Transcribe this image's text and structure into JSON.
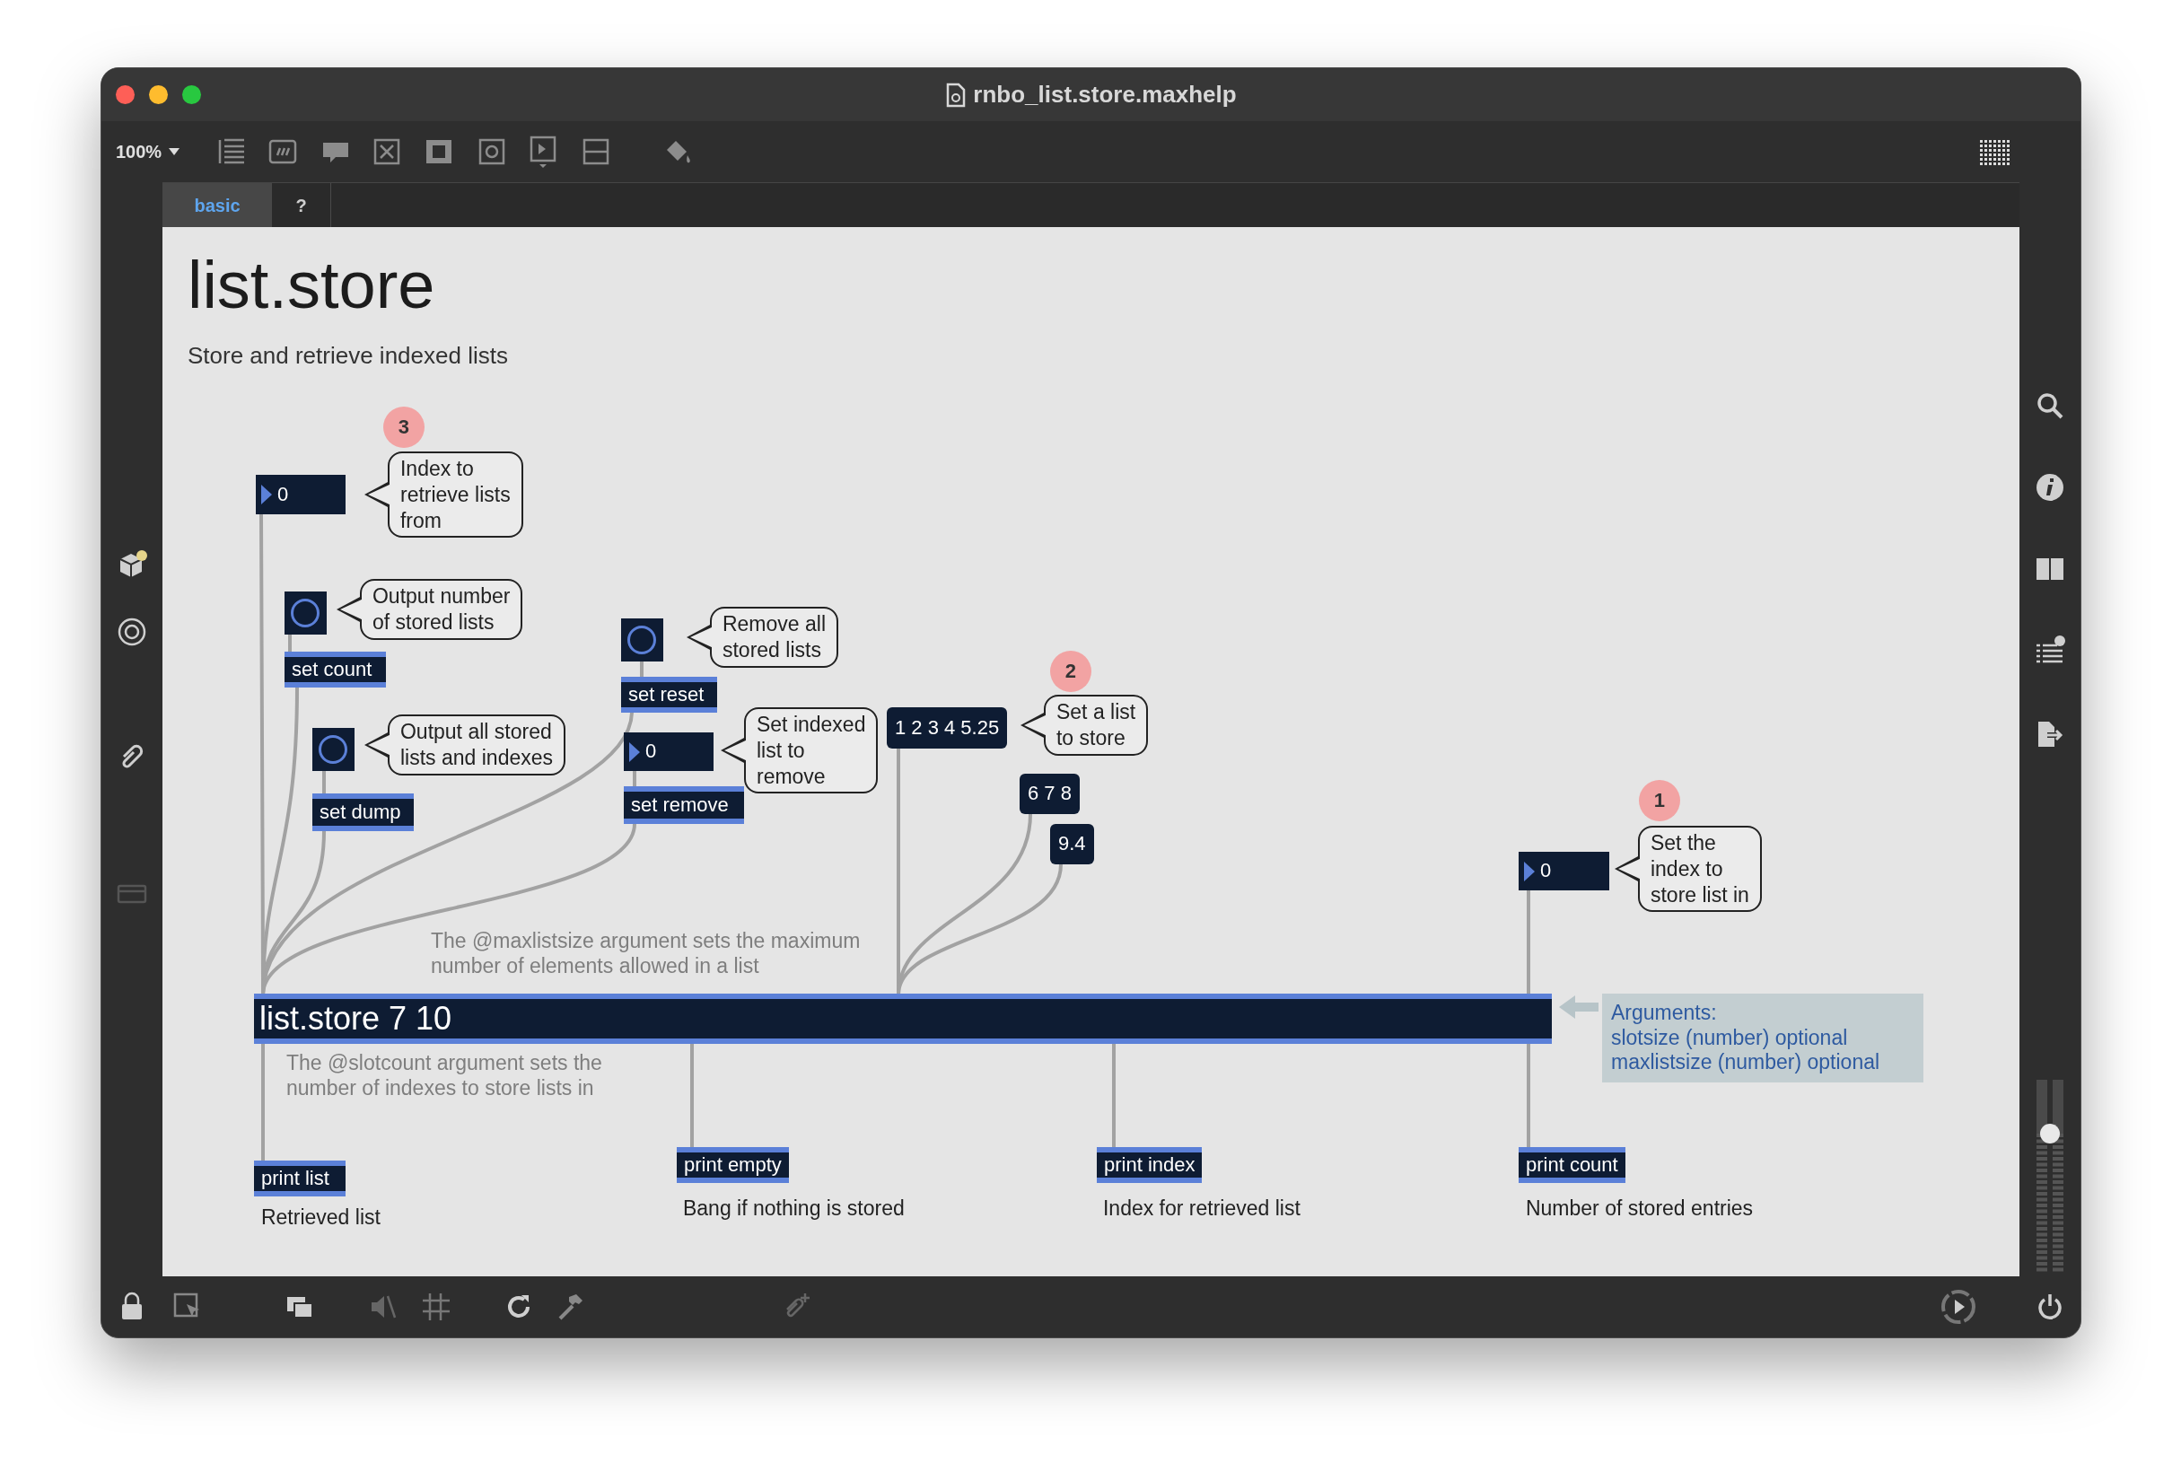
{
  "window": {
    "title": "rnbo_list.store.maxhelp"
  },
  "toolbar": {
    "zoom": "100%"
  },
  "tabs": [
    {
      "label": "basic",
      "selected": true
    },
    {
      "label": "?",
      "selected": false
    }
  ],
  "patcher": {
    "title": "list.store",
    "subtitle": "Store and retrieve indexed lists",
    "objects": [
      {
        "kind": "badge",
        "text": "3"
      },
      {
        "kind": "number",
        "text": "0"
      },
      {
        "kind": "callout",
        "lines": [
          "Index to",
          "retrieve lists",
          "from"
        ]
      },
      {
        "kind": "button"
      },
      {
        "kind": "callout",
        "lines": [
          "Output number",
          "of stored lists"
        ]
      },
      {
        "kind": "object",
        "text": "set count"
      },
      {
        "kind": "button"
      },
      {
        "kind": "callout",
        "lines": [
          "Output all stored",
          "lists and indexes"
        ]
      },
      {
        "kind": "object",
        "text": "set dump"
      },
      {
        "kind": "button"
      },
      {
        "kind": "callout",
        "lines": [
          "Remove all",
          "stored lists"
        ]
      },
      {
        "kind": "object",
        "text": "set reset"
      },
      {
        "kind": "badge",
        "text": "2"
      },
      {
        "kind": "number",
        "text": "0"
      },
      {
        "kind": "callout",
        "lines": [
          "Set indexed",
          "list to",
          "remove"
        ]
      },
      {
        "kind": "message",
        "text": "1 2 3 4 5.25"
      },
      {
        "kind": "callout",
        "lines": [
          "Set a list",
          "to store"
        ]
      },
      {
        "kind": "object",
        "text": "set remove"
      },
      {
        "kind": "message",
        "text": "6 7 8"
      },
      {
        "kind": "message",
        "text": "9.4"
      },
      {
        "kind": "badge",
        "text": "1"
      },
      {
        "kind": "number",
        "text": "0"
      },
      {
        "kind": "callout",
        "lines": [
          "Set the",
          "index to",
          "store list in"
        ]
      },
      {
        "kind": "note",
        "lines": [
          "The @maxlistsize argument sets the maximum",
          "number of elements allowed in a list"
        ]
      },
      {
        "kind": "object",
        "text": "list.store 7 10"
      },
      {
        "kind": "arguments",
        "lines": [
          "Arguments:",
          "slotsize (number) optional",
          "maxlistsize (number) optional"
        ]
      },
      {
        "kind": "note",
        "lines": [
          "The @slotcount argument sets the",
          "number of indexes to store lists in"
        ]
      },
      {
        "kind": "object",
        "text": "print list"
      },
      {
        "kind": "comment",
        "lines": [
          "Retrieved list"
        ]
      },
      {
        "kind": "object",
        "text": "print empty"
      },
      {
        "kind": "comment",
        "lines": [
          "Bang if nothing is stored"
        ]
      },
      {
        "kind": "object",
        "text": "print index"
      },
      {
        "kind": "comment",
        "lines": [
          "Index for retrieved list"
        ]
      },
      {
        "kind": "object",
        "text": "print count"
      },
      {
        "kind": "comment",
        "lines": [
          "Number of stored entries"
        ]
      }
    ]
  },
  "volume": {
    "level": 0.75
  }
}
